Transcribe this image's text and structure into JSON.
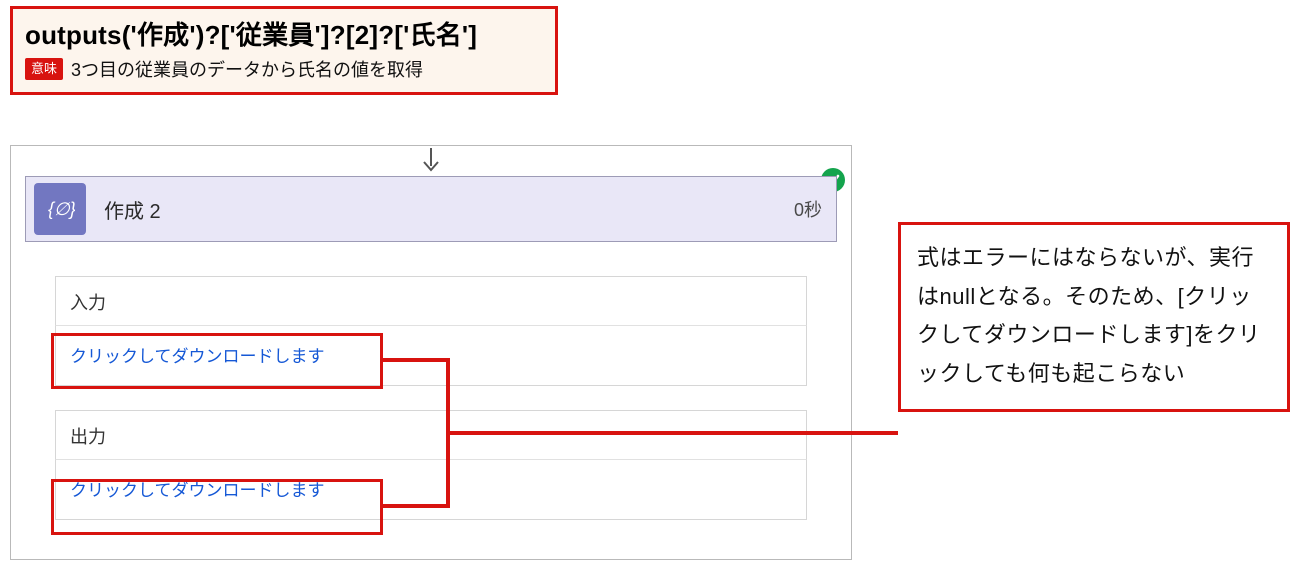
{
  "expression": {
    "code": "outputs('作成')?['従業員']?[2]?['氏名']",
    "meaning_badge": "意味",
    "meaning_text": "3つ目の従業員のデータから氏名の値を取得"
  },
  "flow_card": {
    "title": "作成 2",
    "duration": "0秒",
    "status": "success"
  },
  "sections": {
    "input": {
      "label": "入力",
      "download_link": "クリックしてダウンロードします"
    },
    "output": {
      "label": "出力",
      "download_link": "クリックしてダウンロードします"
    }
  },
  "callout": {
    "text": "式はエラーにはならないが、実行はnullとなる。そのため、[クリックしてダウンロードします]をクリックしても何も起こらない"
  },
  "colors": {
    "highlight": "#d8130f",
    "card_bg": "#e9e7f7",
    "icon_bg": "#7277c1",
    "link": "#1558d6",
    "success": "#14a44d"
  }
}
